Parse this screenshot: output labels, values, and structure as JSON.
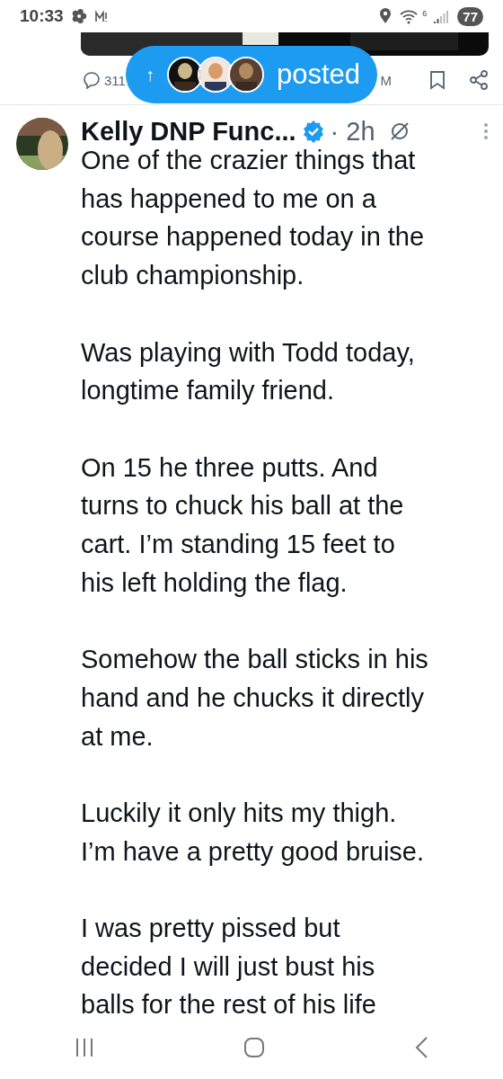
{
  "status_bar": {
    "time": "10:33",
    "wifi_badge": "6",
    "battery": "77"
  },
  "previous_post": {
    "actions": {
      "replies": "311",
      "views": "M"
    }
  },
  "new_posts_pill": {
    "arrow": "↑",
    "label": "posted"
  },
  "post": {
    "author": "Kelly DNP Func...",
    "verified": true,
    "time": "· 2h",
    "paragraphs": [
      [
        "One of the crazier things that",
        "has happened to me on a",
        "course happened today in the",
        "club championship."
      ],
      [
        "Was playing with Todd today,",
        "longtime family friend."
      ],
      [
        "On 15 he three putts. And",
        "turns to chuck his ball at the",
        "cart. I’m standing 15 feet to",
        "his left holding the flag."
      ],
      [
        "Somehow the ball sticks in his",
        "hand and he chucks it directly",
        "at me."
      ],
      [
        "Luckily it only hits my thigh.",
        "I’m have a pretty good bruise."
      ],
      [
        "I was pretty pissed but",
        "decided I will just bust his",
        "balls for the rest of his life"
      ]
    ]
  }
}
